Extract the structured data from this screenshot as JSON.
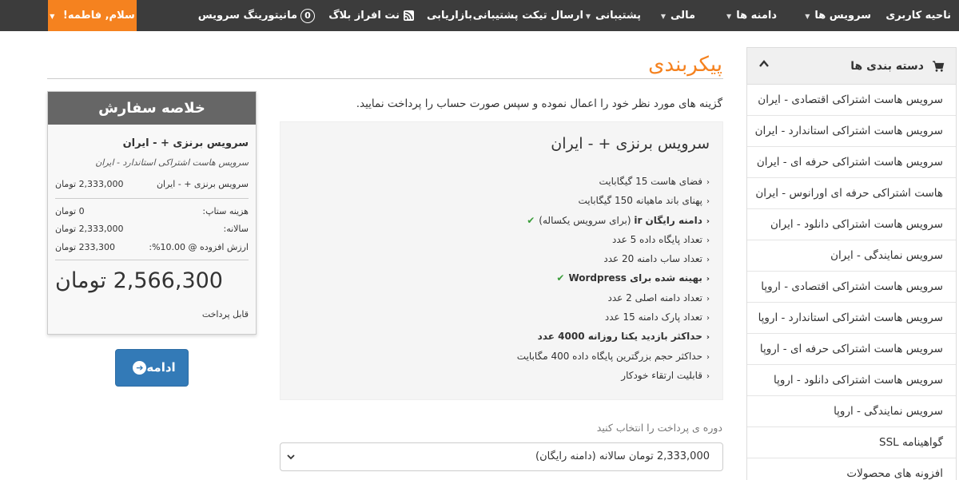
{
  "navbar": {
    "user_greeting": "سلام, فاطمه!",
    "items": [
      {
        "label": "ناحیه کاربری",
        "dropdown": false
      },
      {
        "label": "سرویس ها",
        "dropdown": true
      },
      {
        "label": "دامنه ها",
        "dropdown": true
      },
      {
        "label": "مالی",
        "dropdown": true
      },
      {
        "label": "پشتیبانی",
        "dropdown": true
      },
      {
        "label": "ارسال تیکت پشتیبانی",
        "dropdown": false
      },
      {
        "label": "بازاریابی",
        "dropdown": false
      },
      {
        "label": "نت افراز بلاگ",
        "dropdown": false
      },
      {
        "label": "مانیتورینگ سرویس",
        "dropdown": false,
        "badge": "0"
      }
    ]
  },
  "sidebar": {
    "title": "دسته بندی ها",
    "items": [
      "سرویس هاست اشتراکی اقتصادی - ایران",
      "سرویس هاست اشتراکی استاندارد - ایران",
      "سرویس هاست اشتراکی حرفه ای - ایران",
      "هاست اشتراکی حرفه ای اورانوس - ایران",
      "سرویس هاست اشتراکی دانلود - ایران",
      "سرویس نمایندگی - ایران",
      "سرویس هاست اشتراکی اقتصادی - اروپا",
      "سرویس هاست اشتراکی استاندارد - اروپا",
      "سرویس هاست اشتراکی حرفه ای - اروپا",
      "سرویس هاست اشتراکی دانلود - اروپا",
      "سرویس نمایندگی - اروپا",
      "گواهینامه SSL",
      "افزونه های محصولات"
    ]
  },
  "page": {
    "title": "پیکربندی",
    "intro": "گزینه های مورد نظر خود را اعمال نموده و سپس صورت حساب را پرداخت نمایید."
  },
  "product": {
    "name": "سرویس برنزی + - ایران",
    "features": [
      {
        "text": "فضای هاست 15 گیگابایت",
        "bold": false,
        "check": false
      },
      {
        "text": "پهنای باند ماهیانه 150 گیگابایت",
        "bold": false,
        "check": false
      },
      {
        "text": "دامنه رایگان ir",
        "extra": "(برای سرویس یکساله)",
        "bold": true,
        "check": true
      },
      {
        "text": "تعداد پایگاه داده 5 عدد",
        "bold": false,
        "check": false
      },
      {
        "text": "تعداد ساب دامنه 20 عدد",
        "bold": false,
        "check": false
      },
      {
        "text": "بهینه شده برای Wordpress",
        "bold": true,
        "check": true
      },
      {
        "text": "تعداد دامنه اصلی 2 عدد",
        "bold": false,
        "check": false
      },
      {
        "text": "تعداد پارک دامنه 15 عدد",
        "bold": false,
        "check": false
      },
      {
        "text": "حداکثر بازدید یکتا روزانه 4000 عدد",
        "bold": true,
        "check": false
      },
      {
        "text": "حداکثر حجم بزرگترین پایگاه داده 400 مگابایت",
        "bold": false,
        "check": false
      },
      {
        "text": "قابلیت ارتقاء خودکار",
        "bold": false,
        "check": false
      }
    ]
  },
  "billing_cycle": {
    "label": "دوره ی پرداخت را انتخاب کنید",
    "selected": "2,333,000 تومان سالانه (دامنه رایگان)"
  },
  "summary": {
    "title": "خلاصه سفارش",
    "product_name": "سرویس برنزی + - ایران",
    "product_group": "سرویس هاست اشتراکی استاندارد - ایران",
    "line_label": "سرویس برنزی + - ایران",
    "line_price": "2,333,000 تومان",
    "setup_label": "هزینه ستاپ:",
    "setup_value": "0 تومان",
    "annual_label": "سالانه:",
    "annual_value": "2,333,000 تومان",
    "vat_label": "ارزش افزوده @ 10.00%:",
    "vat_value": "233,300 تومان",
    "total": "2,566,300 تومان",
    "total_due_label": "قابل پرداخت"
  },
  "continue_button": "ادامه",
  "colors": {
    "accent": "#f5821f",
    "navbar": "#3c3c3c",
    "primary": "#337ab7",
    "check": "#3a9d3a"
  }
}
